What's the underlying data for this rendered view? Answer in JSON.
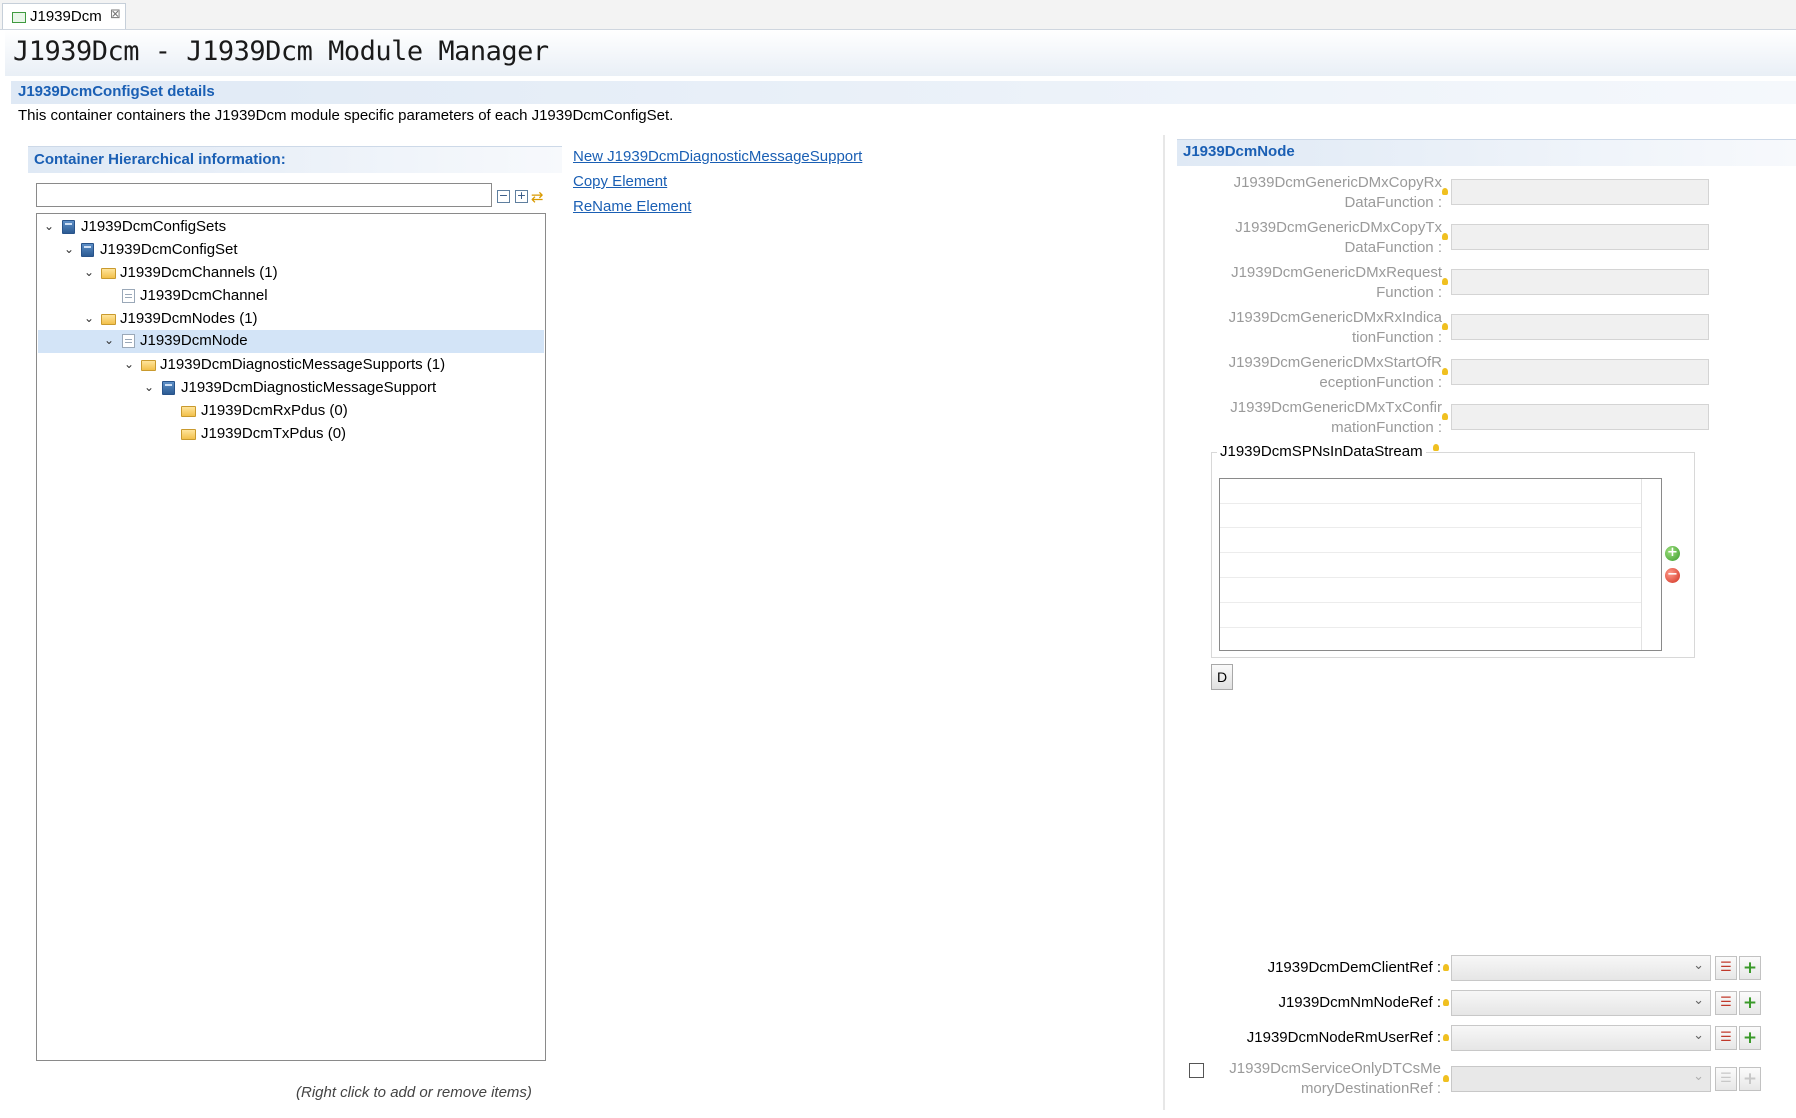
{
  "editor": {
    "tab_label": "J1939Dcm",
    "tab_close": "⊠",
    "page_title": "J1939Dcm - J1939Dcm Module Manager"
  },
  "section": {
    "title": "J1939DcmConfigSet details",
    "description": "This container containers the J1939Dcm module specific parameters of each J1939DcmConfigSet."
  },
  "hierarchy": {
    "title": "Container Hierarchical information:",
    "filter_value": "",
    "collapse_all": "−",
    "expand_all": "+",
    "link_icon": "⇄",
    "hint": "(Right click to add or remove items)",
    "items": [
      {
        "label": "J1939DcmConfigSets",
        "icon": "config-icon",
        "expanded": true
      },
      {
        "label": "J1939DcmConfigSet",
        "icon": "config-icon",
        "expanded": true
      },
      {
        "label": "J1939DcmChannels (1)",
        "icon": "folder-icon",
        "expanded": true
      },
      {
        "label": "J1939DcmChannel",
        "icon": "file-icon",
        "expanded": false
      },
      {
        "label": "J1939DcmNodes (1)",
        "icon": "folder-icon",
        "expanded": true
      },
      {
        "label": "J1939DcmNode",
        "icon": "file-icon",
        "expanded": true,
        "selected": true
      },
      {
        "label": "J1939DcmDiagnosticMessageSupports (1)",
        "icon": "folder-icon",
        "expanded": true
      },
      {
        "label": "J1939DcmDiagnosticMessageSupport",
        "icon": "config-icon",
        "expanded": true
      },
      {
        "label": "J1939DcmRxPdus (0)",
        "icon": "folder-icon",
        "expanded": false
      },
      {
        "label": "J1939DcmTxPdus (0)",
        "icon": "folder-icon",
        "expanded": false
      }
    ]
  },
  "actions": {
    "new_element": "New J1939DcmDiagnosticMessageSupport",
    "copy_element": "Copy Element",
    "rename_element": "ReName Element"
  },
  "node_panel": {
    "title": "J1939DcmNode",
    "functions": [
      {
        "line1": "J1939DcmGenericDMxCopyRx",
        "line2": "DataFunction :",
        "value": ""
      },
      {
        "line1": "J1939DcmGenericDMxCopyTx",
        "line2": "DataFunction :",
        "value": ""
      },
      {
        "line1": "J1939DcmGenericDMxRequest",
        "line2": "Function :",
        "value": ""
      },
      {
        "line1": "J1939DcmGenericDMxRxIndica",
        "line2": "tionFunction :",
        "value": ""
      },
      {
        "line1": "J1939DcmGenericDMxStartOfR",
        "line2": "eceptionFunction :",
        "value": ""
      },
      {
        "line1": "J1939DcmGenericDMxTxConfir",
        "line2": "mationFunction :",
        "value": ""
      }
    ],
    "spns": {
      "title": "J1939DcmSPNsInDataStream",
      "add": "+",
      "remove": "−",
      "d_button": "D"
    },
    "refs": [
      {
        "label": "J1939DcmDemClientRef :",
        "value": ""
      },
      {
        "label": "J1939DcmNmNodeRef :",
        "value": ""
      },
      {
        "label": "J1939DcmNodeRmUserRef :",
        "value": ""
      }
    ],
    "dtc_ref": {
      "line1": "J1939DcmServiceOnlyDTCsMe",
      "line2": "moryDestinationRef :",
      "checked": false,
      "value": ""
    },
    "icons": {
      "chevron": "⌄",
      "list": "☰",
      "add": "+"
    }
  },
  "colors": {
    "accent": "#1a5fb4",
    "selection": "#d3e4f7",
    "disabled_text": "#9a9a9a"
  }
}
